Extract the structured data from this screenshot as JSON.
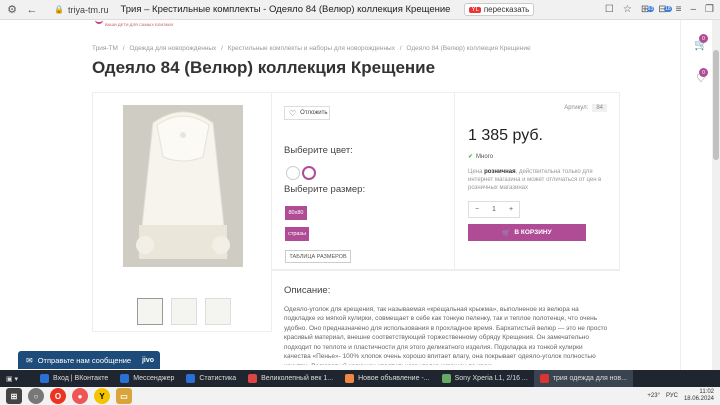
{
  "browser": {
    "url": "triya-tm.ru",
    "tab_title": "Трия – Крестильные комплекты - Одеяло 84 (Велюр) коллекция Крещение / Детс...",
    "retell_label": "пересказать",
    "retell_prefix": "YL",
    "ext_badge_1": "93",
    "ext_badge_2": "18"
  },
  "site": {
    "logo_tagline": "ВАШИ ДЕТИ ДЛЯ САМЫХ БЛИЗКИХ"
  },
  "breadcrumb": [
    "Трия-ТМ",
    "/",
    "Одежда для новорожденных",
    "/",
    "Крестильные комплекты и наборы для новорожденных",
    "/",
    "Одеяло 84 (Велюр) коллекция Крещение"
  ],
  "product": {
    "title": "Одеяло 84 (Велюр) коллекция Крещение",
    "postpone_label": "Отложить",
    "choose_color_label": "Выберите цвет:",
    "choose_size_label": "Выберите размер:",
    "sizes": [
      "80х80",
      "стразы"
    ],
    "size_table_label": "ТАБЛИЦА РАЗМЕРОВ",
    "article_label": "Артикул:",
    "article_value": "84",
    "price": "1 385 руб.",
    "stock": "Много",
    "price_note_prefix": "Цена",
    "price_note_bold": "розничная",
    "price_note_suffix": ", действительна только для интернет магазина и может отличаться от цен в розничных магазинах",
    "qty": "1",
    "qty_minus": "−",
    "qty_plus": "+",
    "cart_button": "В КОРЗИНУ",
    "description_title": "Описание:",
    "description": "Одеяло-уголок для крещения, так называемая «крещальная крыжма», выполненое из велюра на подкладке из мягкой кулирки, совмещает в себе как тонкую пеленку, так и теплое полотенце, что очень удобно. Оно предназначено для использования в прохладное время. Бархатистый велюр — это не просто красивый материал, внешне соответствующий торжественному обряду Крещения. Он замечательно подходит по теплоте и пластичности для этого деликатного изделия. Подкладка из тонкой кулирки качества «Пенье»- 100% хлопок очень хорошо впитает влагу, она покрывает одеяло-уголок полностью изнутри. Велюровый капюшон крестильного уголка украшен по краю"
  },
  "rail": {
    "cart_count": "0",
    "fav_count": "0"
  },
  "chat": {
    "label": "Отправьте нам сообщение",
    "brand": "jivo"
  },
  "taskbar": {
    "items": [
      {
        "label": "Вход | ВКонтакте",
        "color": "#2a6fd6"
      },
      {
        "label": "Мессенджер",
        "color": "#2a6fd6"
      },
      {
        "label": "Статистика",
        "color": "#2a6fd6"
      },
      {
        "label": "Великолепный век 1...",
        "color": "#d44"
      },
      {
        "label": "Новое объявление -...",
        "color": "#e84"
      },
      {
        "label": "Sony Xperia L1, 2/16 ...",
        "color": "#6a6"
      },
      {
        "label": "трия одежда для нов...",
        "color": "#d33"
      }
    ],
    "weather": "+23°",
    "lang": "РУС",
    "time": "11:02",
    "date": "18.06.2024"
  },
  "colors": {
    "accent": "#b04c96",
    "chat": "#1e4c7a",
    "taskbar": "#1f2630"
  }
}
